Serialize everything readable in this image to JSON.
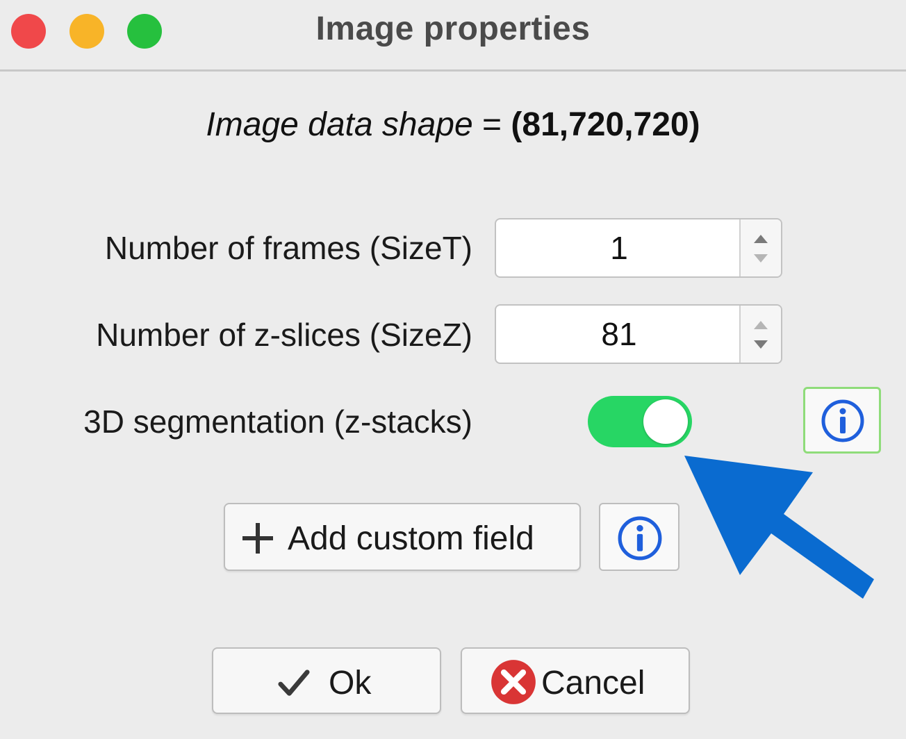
{
  "window": {
    "title": "Image properties",
    "traffic_lights": {
      "close_color": "#f0484a",
      "minimize_color": "#f8b428",
      "zoom_color": "#26c03e"
    }
  },
  "header": {
    "shape_label": "Image data shape",
    "equals": " = ",
    "shape_value": "(81,720,720)"
  },
  "fields": {
    "frames": {
      "label": "Number of frames (SizeT)",
      "value": "1"
    },
    "zslices": {
      "label": "Number of z-slices (SizeZ)",
      "value": "81"
    },
    "segmentation3d": {
      "label": "3D segmentation (z-stacks)",
      "enabled": true,
      "toggle_color": "#27d664"
    }
  },
  "buttons": {
    "add_custom_field": "Add custom field",
    "ok": "Ok",
    "cancel": "Cancel"
  },
  "icons": {
    "info": "info-icon",
    "plus": "plus-icon",
    "check": "checkmark-icon",
    "cancel": "cancel-x-icon",
    "arrow_up": "arrow-up-icon",
    "arrow_down": "arrow-down-icon",
    "annotation_arrow": "annotation-arrow-icon"
  },
  "colors": {
    "info_blue": "#1f5fdc",
    "info_active_border": "#8fdc7a",
    "annotation_arrow": "#0a6bd0",
    "cancel_red": "#d93535"
  }
}
